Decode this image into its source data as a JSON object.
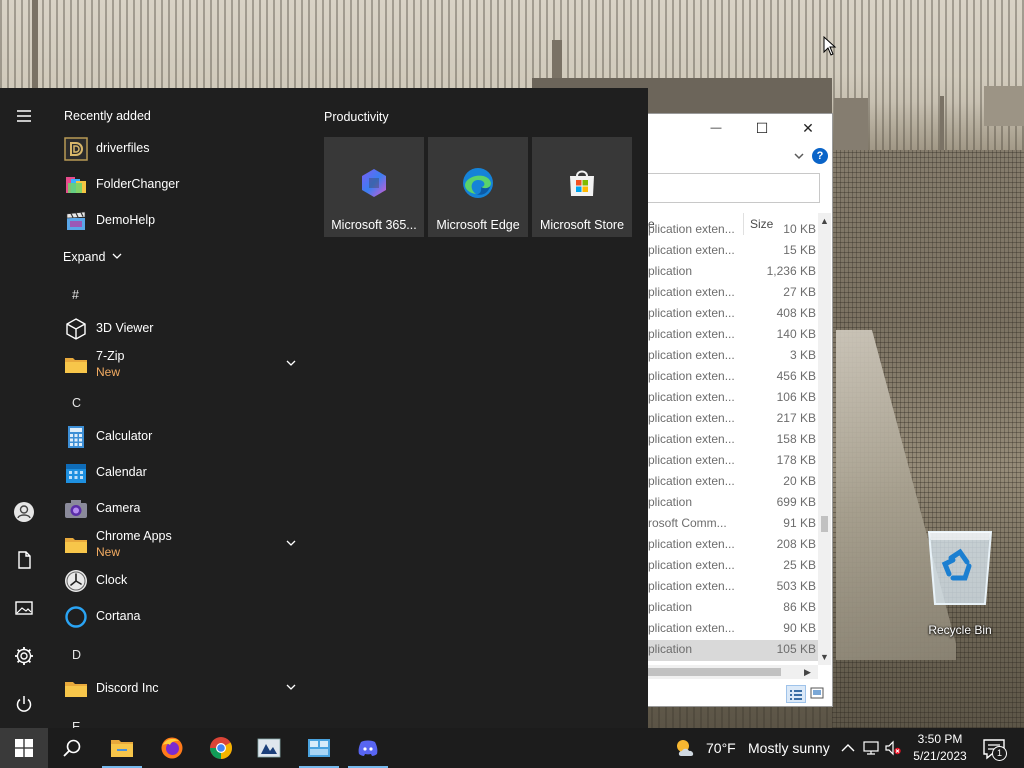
{
  "desktop": {
    "icons": [
      {
        "label": "Recycle Bin"
      }
    ]
  },
  "explorer": {
    "controls": {
      "minimize": "—",
      "maximize": "☐",
      "close": "✕",
      "help": "?"
    },
    "columns": {
      "type": "e",
      "size": "Size"
    },
    "rows": [
      {
        "type": "plication exten...",
        "size": "10 KB"
      },
      {
        "type": "plication exten...",
        "size": "15 KB"
      },
      {
        "type": "plication",
        "size": "1,236 KB"
      },
      {
        "type": "plication exten...",
        "size": "27 KB"
      },
      {
        "type": "plication exten...",
        "size": "408 KB"
      },
      {
        "type": "plication exten...",
        "size": "140 KB"
      },
      {
        "type": "plication exten...",
        "size": "3 KB"
      },
      {
        "type": "plication exten...",
        "size": "456 KB"
      },
      {
        "type": "plication exten...",
        "size": "106 KB"
      },
      {
        "type": "plication exten...",
        "size": "217 KB"
      },
      {
        "type": "plication exten...",
        "size": "158 KB"
      },
      {
        "type": "plication exten...",
        "size": "178 KB"
      },
      {
        "type": "plication exten...",
        "size": "20 KB"
      },
      {
        "type": "plication",
        "size": "699 KB"
      },
      {
        "type": "rosoft Comm...",
        "size": "91 KB"
      },
      {
        "type": "plication exten...",
        "size": "208 KB"
      },
      {
        "type": "plication exten...",
        "size": "25 KB"
      },
      {
        "type": "plication exten...",
        "size": "503 KB"
      },
      {
        "type": "plication",
        "size": "86 KB"
      },
      {
        "type": "plication exten...",
        "size": "90 KB"
      },
      {
        "type": "plication",
        "size": "105 KB",
        "selected": true
      }
    ]
  },
  "start_menu": {
    "recently_added_title": "Recently added",
    "recent_apps": [
      {
        "name": "driverfiles",
        "icon": "driverfiles-icon"
      },
      {
        "name": "FolderChanger",
        "icon": "folderchanger-icon"
      },
      {
        "name": "DemoHelp",
        "icon": "demohelp-icon"
      }
    ],
    "expand_label": "Expand",
    "letters": {
      "hash": "#",
      "c": "C",
      "d": "D",
      "e": "E"
    },
    "apps": [
      {
        "name": "3D Viewer",
        "icon": "cube-icon"
      },
      {
        "name": "7-Zip",
        "sub": "New",
        "icon": "folder-icon",
        "expandable": true
      },
      {
        "name": "Calculator",
        "icon": "calculator-icon"
      },
      {
        "name": "Calendar",
        "icon": "calendar-icon"
      },
      {
        "name": "Camera",
        "icon": "camera-icon"
      },
      {
        "name": "Chrome Apps",
        "sub": "New",
        "icon": "folder-icon",
        "expandable": true
      },
      {
        "name": "Clock",
        "icon": "clock-icon"
      },
      {
        "name": "Cortana",
        "icon": "cortana-icon"
      },
      {
        "name": "Discord Inc",
        "icon": "folder-icon",
        "expandable": true
      }
    ],
    "tiles_group_title": "Productivity",
    "tiles": [
      {
        "name": "Microsoft 365...",
        "icon": "microsoft-365-icon"
      },
      {
        "name": "Microsoft Edge",
        "icon": "edge-icon"
      },
      {
        "name": "Microsoft Store",
        "icon": "store-icon"
      }
    ],
    "rail": [
      "hamburger-menu-icon",
      "user-icon",
      "documents-icon",
      "pictures-icon",
      "settings-icon",
      "power-icon"
    ]
  },
  "taskbar": {
    "apps": [
      "search-icon",
      "file-explorer-icon",
      "firefox-icon",
      "chrome-icon",
      "app-icon",
      "app-icon-2",
      "discord-icon"
    ],
    "weather": {
      "temp": "70°F",
      "condition": "Mostly sunny"
    },
    "clock": {
      "time": "3:50 PM",
      "date": "5/21/2023"
    },
    "notification_count": "1"
  },
  "colors": {
    "start_bg": "#1f1f1f",
    "tile_bg": "#383838",
    "taskbar_bg": "#1c1c1c",
    "new_badge": "#f3ac62",
    "accent": "#76b9ed"
  }
}
